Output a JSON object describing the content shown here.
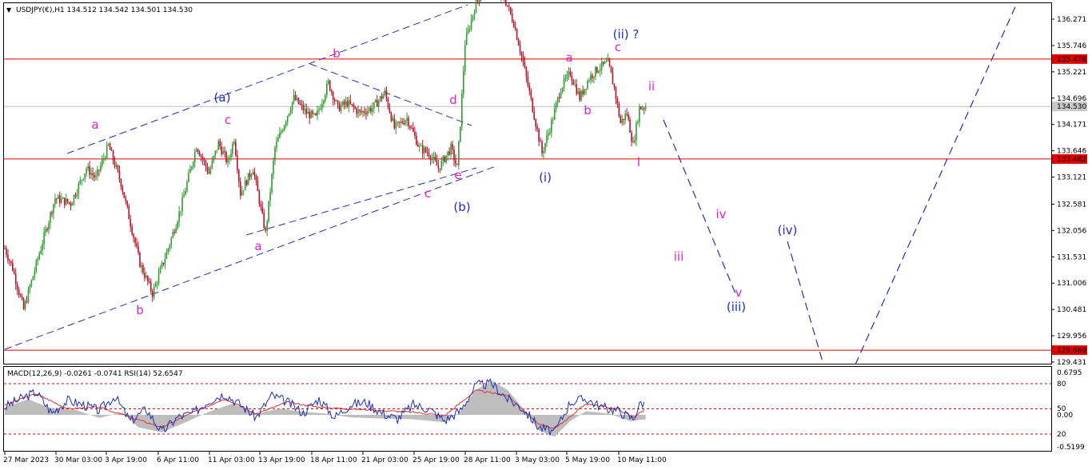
{
  "header": {
    "symbol_line": "USDJPY(€),H1  134.512 134.542 134.501 134.530",
    "indicator_line": "MACD(12,26,9) -0.0261 -0.0741  RSI(14) 52.6547"
  },
  "colors": {
    "background": "#ffffff",
    "bull_candle": "#2e9e2e",
    "bear_candle": "#b8122a",
    "level_line": "#e00000",
    "trend_line": "#1f2fb5",
    "wave_magenta": "#e020d0",
    "wave_blue": "#1f2fb5",
    "rsi_line": "#1f2fb5",
    "signal_line": "#e03030",
    "macd_hist": "#bdbdbd",
    "current_price_line": "#c0c0c0"
  },
  "chart_data": {
    "type": "candlestick",
    "title": "USDJPY(€),H1",
    "ohlc_last": {
      "open": 134.512,
      "high": 134.542,
      "low": 134.501,
      "close": 134.53
    },
    "y_ticks": [
      "136.271",
      "135.746",
      "135.221",
      "134.696",
      "134.171",
      "133.646",
      "133.121",
      "132.581",
      "132.056",
      "131.531",
      "131.006",
      "130.481",
      "129.956",
      "129.431"
    ],
    "x_ticks": [
      "27 Mar 2023",
      "30 Mar 03:00",
      "3 Apr 19:00",
      "6 Apr 11:00",
      "11 Apr 03:00",
      "13 Apr 19:00",
      "18 Apr 11:00",
      "21 Apr 03:00",
      "25 Apr 19:00",
      "28 Apr 11:00",
      "3 May 03:00",
      "5 May 19:00",
      "10 May 11:00"
    ],
    "ylim": [
      129.35,
      136.65
    ],
    "horizontal_levels": [
      {
        "value": 135.476,
        "label": "135.476"
      },
      {
        "value": 133.482,
        "label": "133.482"
      },
      {
        "value": 129.669,
        "label": "129.669"
      }
    ],
    "current_price": {
      "value": 134.53,
      "label": "134.530"
    },
    "price_path_pivots": [
      {
        "bar": 0,
        "price": 131.7
      },
      {
        "bar": 5,
        "price": 131.3
      },
      {
        "bar": 12,
        "price": 130.48
      },
      {
        "bar": 22,
        "price": 131.6
      },
      {
        "bar": 32,
        "price": 132.7
      },
      {
        "bar": 42,
        "price": 132.6
      },
      {
        "bar": 52,
        "price": 133.3
      },
      {
        "bar": 58,
        "price": 133.1
      },
      {
        "bar": 66,
        "price": 133.75
      },
      {
        "bar": 74,
        "price": 133.0
      },
      {
        "bar": 80,
        "price": 132.2
      },
      {
        "bar": 86,
        "price": 131.4
      },
      {
        "bar": 94,
        "price": 130.8
      },
      {
        "bar": 104,
        "price": 131.7
      },
      {
        "bar": 112,
        "price": 132.5
      },
      {
        "bar": 122,
        "price": 133.75
      },
      {
        "bar": 130,
        "price": 133.2
      },
      {
        "bar": 136,
        "price": 133.8
      },
      {
        "bar": 142,
        "price": 133.4
      },
      {
        "bar": 146,
        "price": 133.9
      },
      {
        "bar": 150,
        "price": 132.8
      },
      {
        "bar": 158,
        "price": 133.3
      },
      {
        "bar": 166,
        "price": 132.0
      },
      {
        "bar": 172,
        "price": 133.7
      },
      {
        "bar": 178,
        "price": 134.2
      },
      {
        "bar": 184,
        "price": 134.7
      },
      {
        "bar": 192,
        "price": 134.4
      },
      {
        "bar": 198,
        "price": 134.3
      },
      {
        "bar": 206,
        "price": 135.0
      },
      {
        "bar": 212,
        "price": 134.5
      },
      {
        "bar": 218,
        "price": 134.6
      },
      {
        "bar": 226,
        "price": 134.4
      },
      {
        "bar": 234,
        "price": 134.5
      },
      {
        "bar": 242,
        "price": 134.8
      },
      {
        "bar": 248,
        "price": 134.1
      },
      {
        "bar": 256,
        "price": 134.3
      },
      {
        "bar": 264,
        "price": 133.7
      },
      {
        "bar": 270,
        "price": 133.6
      },
      {
        "bar": 276,
        "price": 133.3
      },
      {
        "bar": 284,
        "price": 133.7
      },
      {
        "bar": 288,
        "price": 133.3
      },
      {
        "bar": 290,
        "price": 134.2
      },
      {
        "bar": 293,
        "price": 135.8
      },
      {
        "bar": 300,
        "price": 136.6
      },
      {
        "bar": 306,
        "price": 136.9
      },
      {
        "bar": 318,
        "price": 136.7
      },
      {
        "bar": 324,
        "price": 136.2
      },
      {
        "bar": 330,
        "price": 135.4
      },
      {
        "bar": 336,
        "price": 134.5
      },
      {
        "bar": 342,
        "price": 133.6
      },
      {
        "bar": 348,
        "price": 134.2
      },
      {
        "bar": 354,
        "price": 134.9
      },
      {
        "bar": 360,
        "price": 135.2
      },
      {
        "bar": 366,
        "price": 134.7
      },
      {
        "bar": 372,
        "price": 135.1
      },
      {
        "bar": 378,
        "price": 135.3
      },
      {
        "bar": 384,
        "price": 135.4
      },
      {
        "bar": 388,
        "price": 134.9
      },
      {
        "bar": 392,
        "price": 134.2
      },
      {
        "bar": 396,
        "price": 134.4
      },
      {
        "bar": 400,
        "price": 133.75
      },
      {
        "bar": 404,
        "price": 134.5
      },
      {
        "bar": 408,
        "price": 134.53
      }
    ]
  },
  "price_axis": {
    "level_labels": [
      "135.476",
      "133.482",
      "129.669"
    ],
    "current_label": "134.530"
  },
  "indicator_axis": {
    "labels": [
      "0.6795",
      "80",
      "50",
      "0.00",
      "20",
      "-0.5199"
    ]
  },
  "wave_labels": [
    {
      "key": "wl_a1",
      "text": "a",
      "color": "magenta"
    },
    {
      "key": "wl_b1",
      "text": "b",
      "color": "magenta"
    },
    {
      "key": "wl_c1",
      "text": "c",
      "color": "magenta"
    },
    {
      "key": "wl_a2",
      "text": "a",
      "color": "magenta"
    },
    {
      "key": "wl_b2",
      "text": "b",
      "color": "magenta"
    },
    {
      "key": "wl_c2",
      "text": "c",
      "color": "magenta"
    },
    {
      "key": "wl_d",
      "text": "d",
      "color": "magenta"
    },
    {
      "key": "wl_e",
      "text": "e",
      "color": "magenta"
    },
    {
      "key": "wl_A",
      "text": "(a)",
      "color": "blue"
    },
    {
      "key": "wl_B",
      "text": "(b)",
      "color": "blue"
    },
    {
      "key": "wl_i_blue",
      "text": "(i)",
      "color": "blue"
    },
    {
      "key": "wl_ii_blue",
      "text": "(ii) ?",
      "color": "blue"
    },
    {
      "key": "wl_a3",
      "text": "a",
      "color": "magenta"
    },
    {
      "key": "wl_b3",
      "text": "b",
      "color": "magenta"
    },
    {
      "key": "wl_c3",
      "text": "c",
      "color": "magenta"
    },
    {
      "key": "wl_i_mag",
      "text": "i",
      "color": "magenta"
    },
    {
      "key": "wl_ii_mag",
      "text": "ii",
      "color": "magenta"
    },
    {
      "key": "wl_iii_mag",
      "text": "iii",
      "color": "magenta"
    },
    {
      "key": "wl_iv_mag",
      "text": "iv",
      "color": "magenta"
    },
    {
      "key": "wl_v_mag",
      "text": "v",
      "color": "magenta"
    },
    {
      "key": "wl_iii_blue",
      "text": "(iii)",
      "color": "blue"
    },
    {
      "key": "wl_iv_blue",
      "text": "(iv)",
      "color": "blue"
    }
  ],
  "indicator_data": {
    "rsi_path": [
      [
        0,
        52
      ],
      [
        10,
        62
      ],
      [
        20,
        70
      ],
      [
        30,
        45
      ],
      [
        40,
        60
      ],
      [
        50,
        55
      ],
      [
        60,
        48
      ],
      [
        70,
        65
      ],
      [
        80,
        35
      ],
      [
        90,
        50
      ],
      [
        100,
        22
      ],
      [
        110,
        40
      ],
      [
        120,
        45
      ],
      [
        130,
        60
      ],
      [
        140,
        68
      ],
      [
        150,
        55
      ],
      [
        160,
        40
      ],
      [
        170,
        66
      ],
      [
        180,
        58
      ],
      [
        190,
        45
      ],
      [
        200,
        62
      ],
      [
        210,
        40
      ],
      [
        220,
        55
      ],
      [
        230,
        58
      ],
      [
        240,
        45
      ],
      [
        250,
        38
      ],
      [
        260,
        55
      ],
      [
        270,
        50
      ],
      [
        280,
        36
      ],
      [
        290,
        48
      ],
      [
        300,
        78
      ],
      [
        310,
        80
      ],
      [
        320,
        62
      ],
      [
        330,
        50
      ],
      [
        340,
        28
      ],
      [
        350,
        22
      ],
      [
        360,
        58
      ],
      [
        370,
        62
      ],
      [
        380,
        52
      ],
      [
        390,
        48
      ],
      [
        400,
        38
      ],
      [
        405,
        58
      ],
      [
        408,
        55
      ]
    ],
    "signal_path": [
      [
        0,
        55
      ],
      [
        20,
        68
      ],
      [
        40,
        50
      ],
      [
        60,
        52
      ],
      [
        80,
        40
      ],
      [
        100,
        28
      ],
      [
        120,
        46
      ],
      [
        140,
        62
      ],
      [
        160,
        44
      ],
      [
        180,
        58
      ],
      [
        200,
        52
      ],
      [
        220,
        50
      ],
      [
        240,
        48
      ],
      [
        260,
        46
      ],
      [
        280,
        42
      ],
      [
        300,
        72
      ],
      [
        320,
        66
      ],
      [
        340,
        32
      ],
      [
        350,
        26
      ],
      [
        370,
        56
      ],
      [
        390,
        50
      ],
      [
        400,
        40
      ],
      [
        408,
        50
      ]
    ],
    "hist_path": [
      [
        0,
        0.12
      ],
      [
        15,
        0.25
      ],
      [
        30,
        0.1
      ],
      [
        45,
        0.08
      ],
      [
        60,
        -0.05
      ],
      [
        75,
        0.04
      ],
      [
        85,
        -0.2
      ],
      [
        100,
        -0.28
      ],
      [
        115,
        -0.12
      ],
      [
        130,
        0.05
      ],
      [
        145,
        0.18
      ],
      [
        160,
        0.02
      ],
      [
        175,
        0.1
      ],
      [
        190,
        0.05
      ],
      [
        205,
        0.02
      ],
      [
        220,
        -0.04
      ],
      [
        240,
        -0.06
      ],
      [
        260,
        -0.07
      ],
      [
        280,
        -0.12
      ],
      [
        290,
        0.05
      ],
      [
        300,
        0.4
      ],
      [
        310,
        0.55
      ],
      [
        320,
        0.4
      ],
      [
        330,
        0.1
      ],
      [
        340,
        -0.25
      ],
      [
        350,
        -0.35
      ],
      [
        360,
        -0.1
      ],
      [
        370,
        0.06
      ],
      [
        385,
        0.02
      ],
      [
        398,
        -0.1
      ],
      [
        408,
        -0.07
      ]
    ]
  }
}
